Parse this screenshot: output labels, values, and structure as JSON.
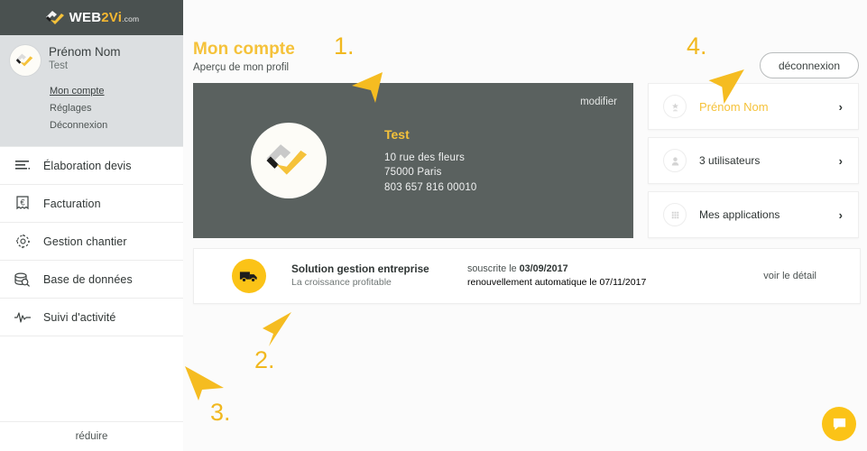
{
  "brand": {
    "logo_text_white": "WEB",
    "logo_text_accent": "2Vi",
    "logo_dotcom": ".com",
    "accent_color": "#f5c23a",
    "yellow_solid": "#fbc317",
    "dark_card": "#5a615f",
    "dark_header": "#4a5150",
    "sidebar_gray": "#dcdfe1"
  },
  "sidebar": {
    "profile": {
      "name": "Prénom Nom",
      "subtitle": "Test",
      "avatar_icon": "company-logo-avatar",
      "links": [
        {
          "label": "Mon compte",
          "active": true
        },
        {
          "label": "Réglages",
          "active": false
        },
        {
          "label": "Déconnexion",
          "active": false
        }
      ]
    },
    "nav": [
      {
        "label": "Élaboration devis",
        "icon": "document-lines-icon"
      },
      {
        "label": "Facturation",
        "icon": "euro-receipt-icon"
      },
      {
        "label": "Gestion chantier",
        "icon": "gear-icon"
      },
      {
        "label": "Base de données",
        "icon": "database-search-icon"
      },
      {
        "label": "Suivi d'activité",
        "icon": "activity-pulse-icon"
      }
    ],
    "collapse_label": "réduire"
  },
  "header": {
    "title": "Mon compte",
    "subtitle": "Aperçu de mon profil",
    "logout_label": "déconnexion"
  },
  "profile_card": {
    "edit_label": "modifier",
    "logo_icon": "web2vi-mark",
    "company": "Test",
    "address_lines": [
      "10 rue des fleurs",
      "75000 Paris",
      "803 657 816 00010"
    ]
  },
  "subscription": {
    "icon": "truck-icon",
    "title": "Solution gestion entreprise",
    "tagline": "La croissance profitable",
    "subscribed_prefix": "souscrite le ",
    "subscribed_date": "03/09/2017",
    "renewal_text": "renouvellement automatique le 07/11/2017",
    "detail_link": "voir le détail"
  },
  "right_cards": [
    {
      "label": "Prénom Nom",
      "icon": "user-star-icon",
      "accent": true,
      "chevron": "›"
    },
    {
      "label": "3 utilisateurs",
      "icon": "users-icon",
      "accent": false,
      "chevron": "›"
    },
    {
      "label": "Mes applications",
      "icon": "grid-apps-icon",
      "accent": false,
      "chevron": "›"
    }
  ],
  "chat": {
    "icon": "chat-bubble-icon"
  },
  "annotations": [
    {
      "number": "1.",
      "icon": "arrow-down-right-icon"
    },
    {
      "number": "2.",
      "icon": "arrow-up-right-icon"
    },
    {
      "number": "3.",
      "icon": "arrow-up-left-icon"
    },
    {
      "number": "4.",
      "icon": "arrow-down-left-icon"
    }
  ]
}
